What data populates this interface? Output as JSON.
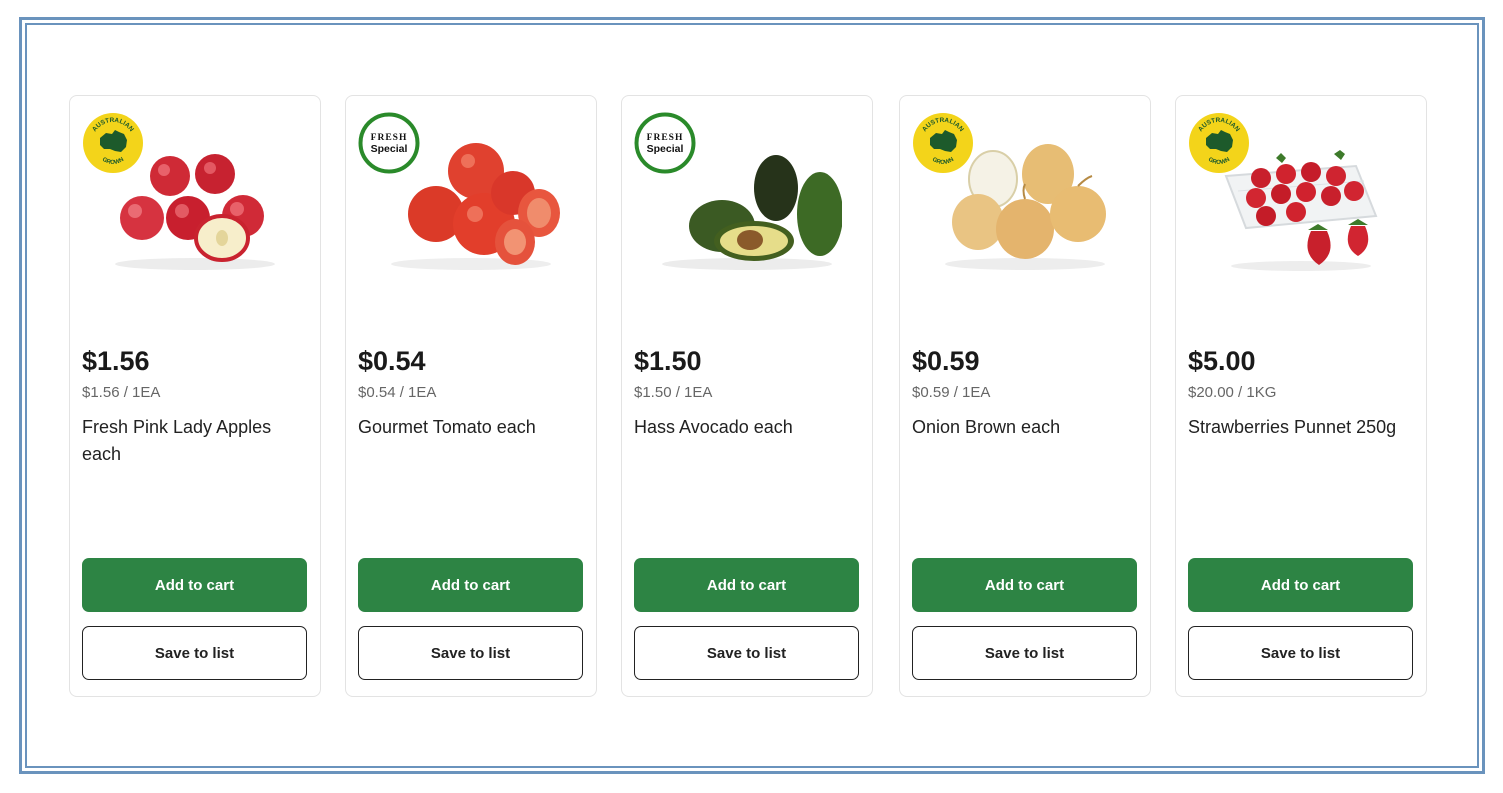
{
  "colors": {
    "frame": "#6a93bd",
    "add_button": "#2d8444",
    "fresh_badge_ring": "#2a8a2a",
    "aus_badge": "#f3d41a"
  },
  "products": [
    {
      "badge": {
        "type": "australian-grown",
        "top_text": "AUSTRALIAN",
        "bottom_text": "GROWN"
      },
      "image": "apples-image",
      "price": "$1.56",
      "unit_price": "$1.56 / 1EA",
      "name": "Fresh Pink Lady Apples each",
      "add_label": "Add to cart",
      "save_label": "Save to list"
    },
    {
      "badge": {
        "type": "fresh-special",
        "line1": "FRESH",
        "line2": "Special"
      },
      "image": "tomatoes-image",
      "price": "$0.54",
      "unit_price": "$0.54 / 1EA",
      "name": "Gourmet Tomato each",
      "add_label": "Add to cart",
      "save_label": "Save to list"
    },
    {
      "badge": {
        "type": "fresh-special",
        "line1": "FRESH",
        "line2": "Special"
      },
      "image": "avocados-image",
      "price": "$1.50",
      "unit_price": "$1.50 / 1EA",
      "name": "Hass Avocado each",
      "add_label": "Add to cart",
      "save_label": "Save to list"
    },
    {
      "badge": {
        "type": "australian-grown",
        "top_text": "AUSTRALIAN",
        "bottom_text": "GROWN"
      },
      "image": "onions-image",
      "price": "$0.59",
      "unit_price": "$0.59 / 1EA",
      "name": "Onion Brown each",
      "add_label": "Add to cart",
      "save_label": "Save to list"
    },
    {
      "badge": {
        "type": "australian-grown",
        "top_text": "AUSTRALIAN",
        "bottom_text": "GROWN"
      },
      "image": "strawberries-image",
      "price": "$5.00",
      "unit_price": "$20.00 / 1KG",
      "name": "Strawberries Punnet 250g",
      "add_label": "Add to cart",
      "save_label": "Save to list"
    }
  ]
}
